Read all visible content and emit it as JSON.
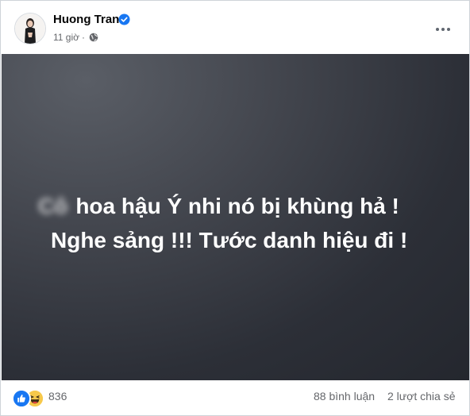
{
  "post": {
    "author": {
      "name": "Huong Tran",
      "verified": true
    },
    "time": "11 giờ",
    "separator": "·",
    "audience_icon": "globe-icon",
    "menu_icon": "more-horizontal-icon",
    "image": {
      "blurred_word": "Cô",
      "line1": "hoa hậu Ý nhi nó bị khùng hả !",
      "line2": "Nghe sảng !!! Tước danh hiệu đi !"
    },
    "stats": {
      "reaction_icons": [
        "like-icon",
        "haha-icon"
      ],
      "reaction_count": "836",
      "comments": "88 bình luận",
      "shares": "2 lượt chia sẻ"
    }
  },
  "colors": {
    "verified": "#1877f2",
    "text_primary": "#050505",
    "text_secondary": "#65676b",
    "image_bg": "#2c2f37",
    "like": "#1877f2",
    "haha": "#f7c94b"
  }
}
